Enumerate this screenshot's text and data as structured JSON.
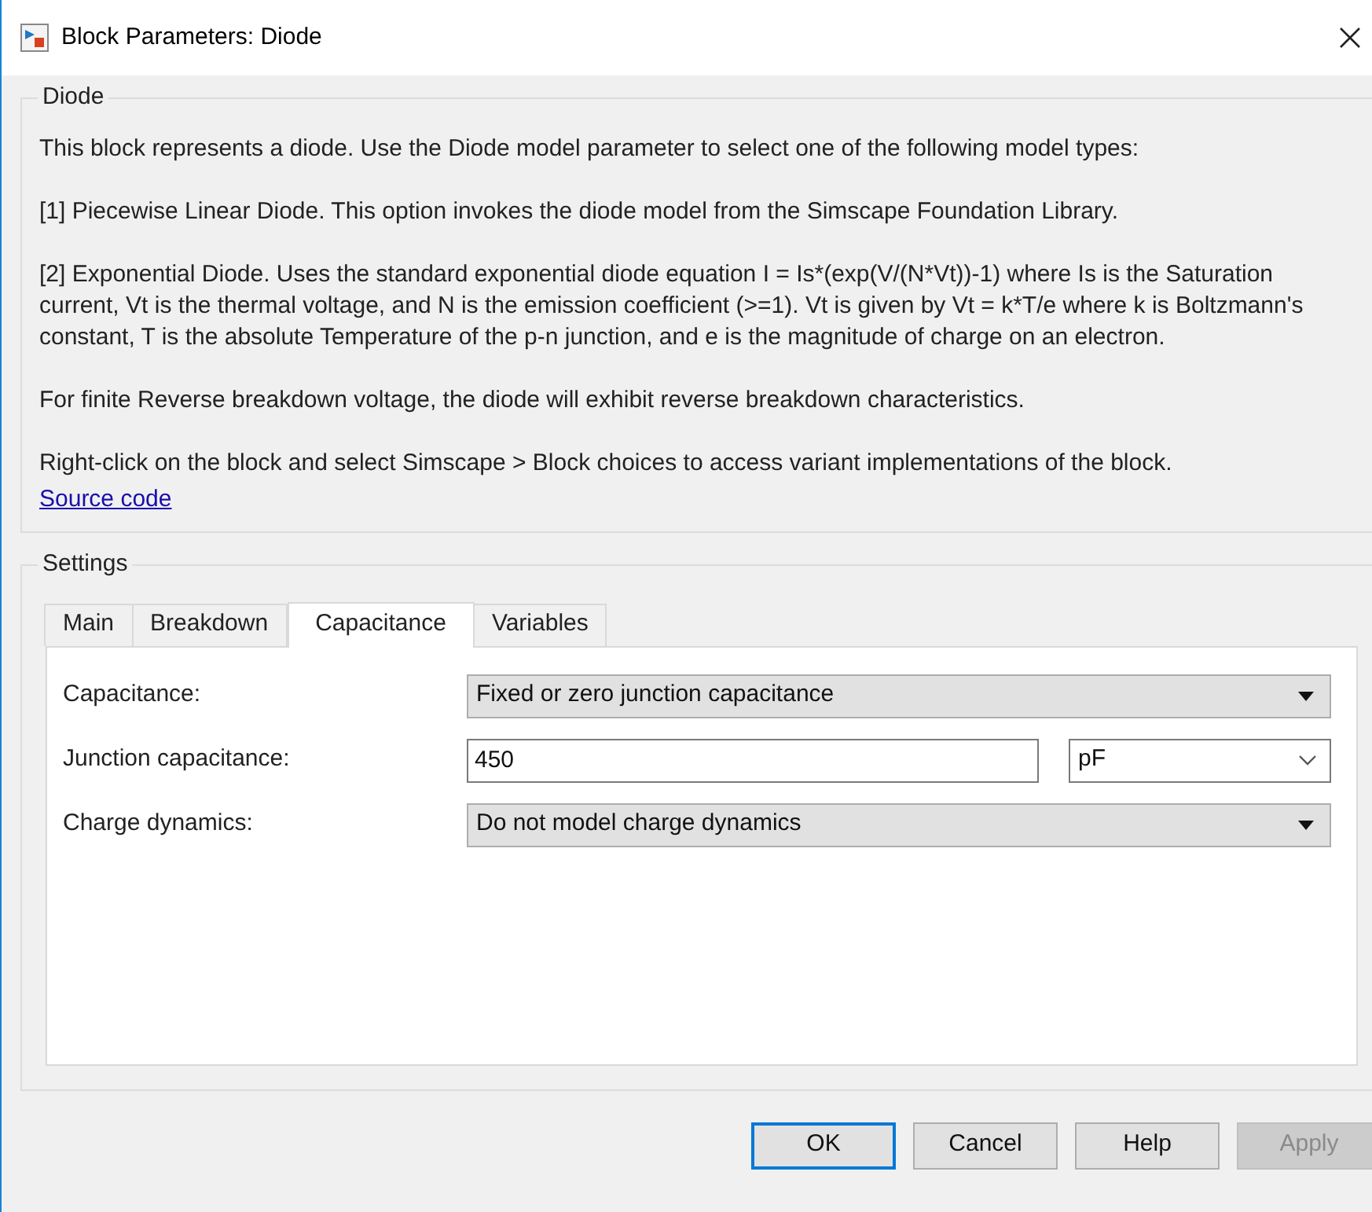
{
  "window": {
    "title": "Block Parameters: Diode"
  },
  "description": {
    "title": "Diode",
    "paragraphs": [
      "This block represents a diode. Use the Diode model parameter to select one of the following model types:",
      "[1] Piecewise Linear Diode. This option invokes the diode model from the Simscape Foundation Library.",
      "[2] Exponential Diode. Uses the standard exponential diode equation I = Is*(exp(V/(N*Vt))-1) where Is is the Saturation current, Vt is the thermal voltage, and N is the emission coefficient (>=1). Vt is given by Vt = k*T/e where k is Boltzmann's constant, T is the absolute Temperature of the p-n junction, and e is the magnitude of charge on an electron.",
      "For finite Reverse breakdown voltage, the diode will exhibit reverse breakdown characteristics.",
      "Right-click on the block and select Simscape > Block choices to access variant implementations of the block."
    ],
    "link": "Source code"
  },
  "settings": {
    "title": "Settings",
    "tabs": [
      {
        "label": "Main",
        "selected": false
      },
      {
        "label": "Breakdown",
        "selected": false
      },
      {
        "label": "Capacitance",
        "selected": true
      },
      {
        "label": "Variables",
        "selected": false
      }
    ],
    "fields": [
      {
        "kind": "dropdown",
        "label": "Capacitance:",
        "value": "Fixed or zero junction capacitance"
      },
      {
        "kind": "value_unit",
        "label": "Junction capacitance:",
        "value": "450",
        "unit": "pF"
      },
      {
        "kind": "dropdown",
        "label": "Charge dynamics:",
        "value": "Do not model charge dynamics"
      }
    ]
  },
  "buttons": [
    {
      "label": "OK",
      "default": true,
      "disabled": false
    },
    {
      "label": "Cancel",
      "default": false,
      "disabled": false
    },
    {
      "label": "Help",
      "default": false,
      "disabled": false
    },
    {
      "label": "Apply",
      "default": false,
      "disabled": true
    }
  ]
}
